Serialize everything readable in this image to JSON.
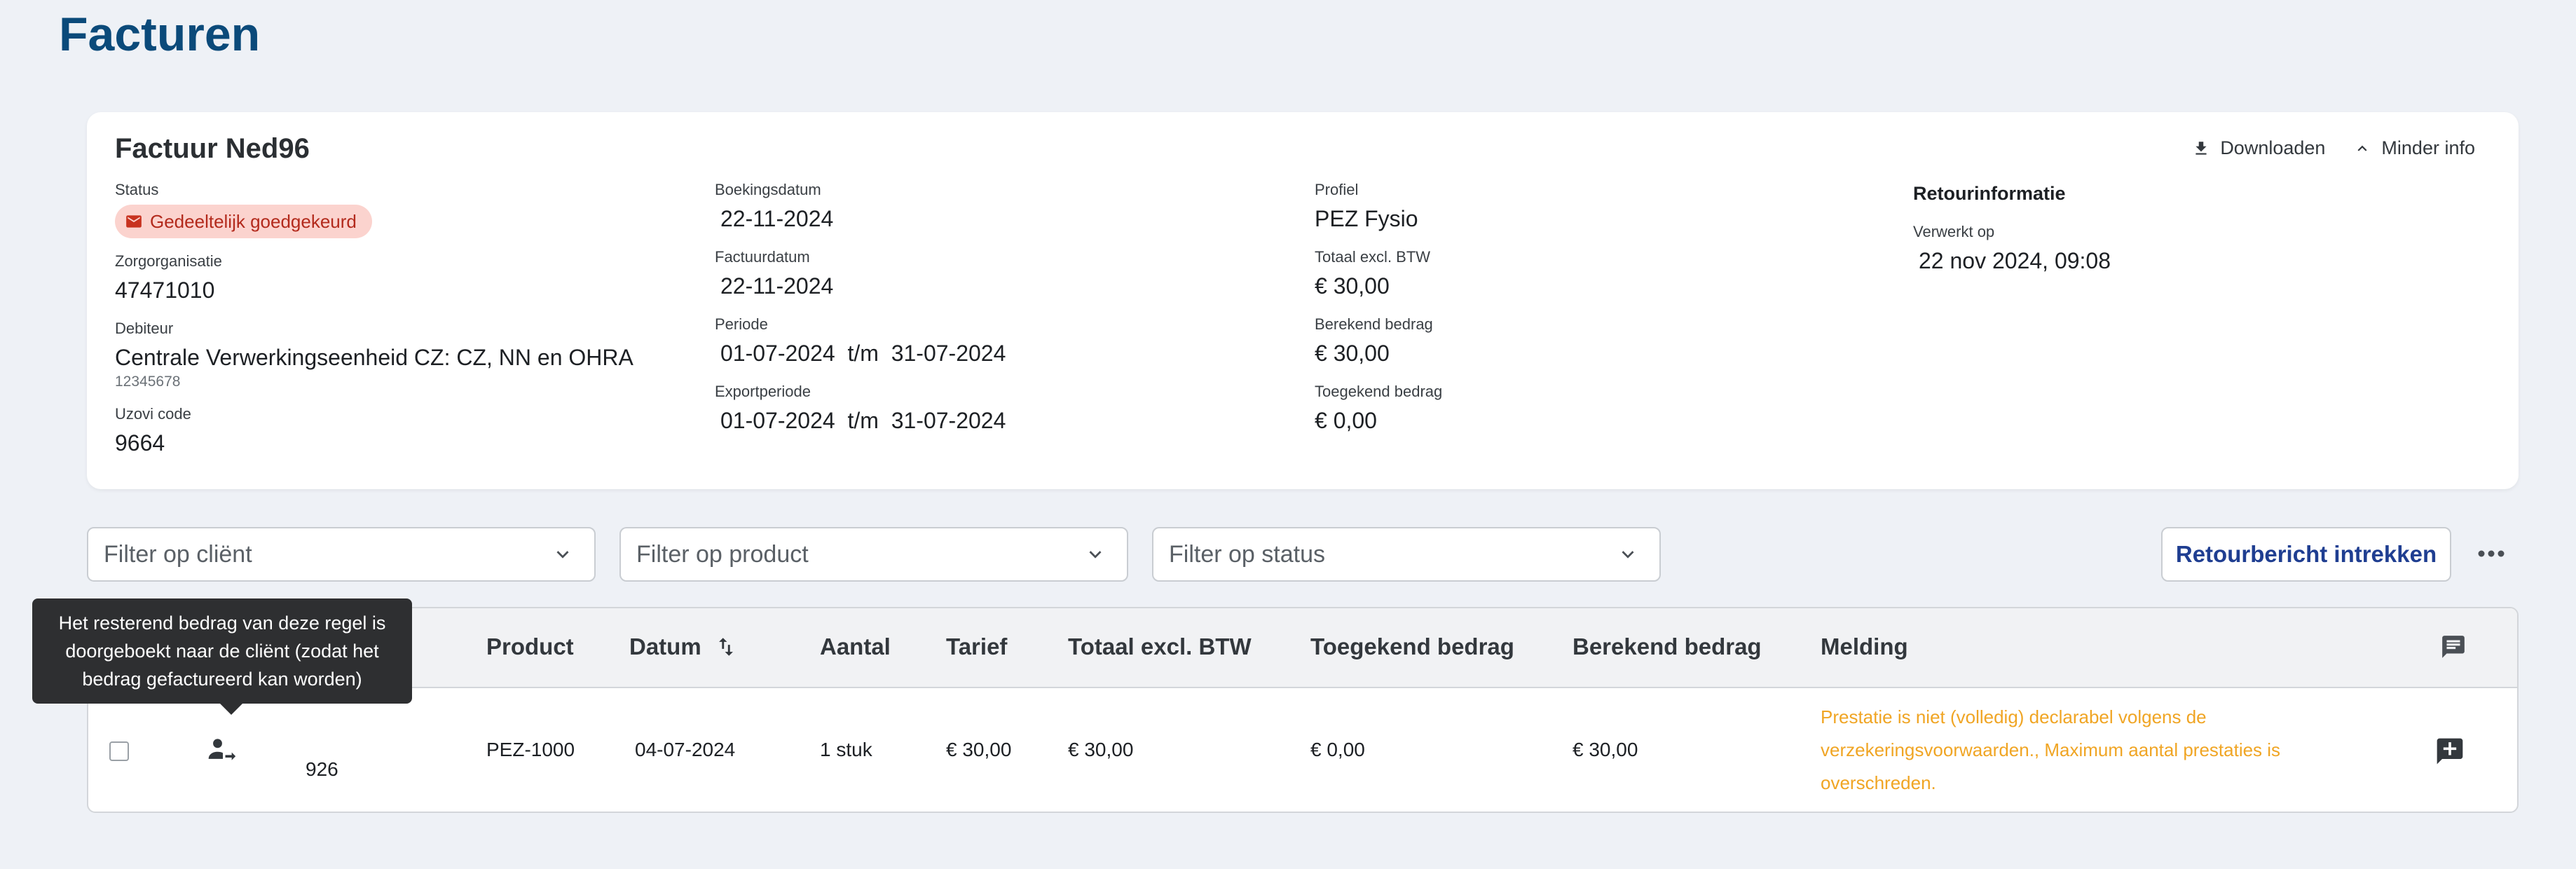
{
  "page": {
    "title": "Facturen"
  },
  "invoice": {
    "title": "Factuur Ned96",
    "actions": {
      "download": "Downloaden",
      "less_info": "Minder info"
    },
    "fields": {
      "status_label": "Status",
      "status_value": "Gedeeltelijk goedgekeurd",
      "zorgorganisatie_label": "Zorgorganisatie",
      "zorgorganisatie_value": "47471010",
      "debiteur_label": "Debiteur",
      "debiteur_value": "Centrale Verwerkingseenheid CZ: CZ, NN en OHRA",
      "debiteur_sub": "12345678",
      "uzovi_label": "Uzovi code",
      "uzovi_value": "9664",
      "boekingsdatum_label": "Boekingsdatum",
      "boekingsdatum_value": "22-11-2024",
      "factuurdatum_label": "Factuurdatum",
      "factuurdatum_value": "22-11-2024",
      "periode_label": "Periode",
      "periode_value": "01-07-2024  t/m  31-07-2024",
      "exportperiode_label": "Exportperiode",
      "exportperiode_value": "01-07-2024  t/m  31-07-2024",
      "profiel_label": "Profiel",
      "profiel_value": "PEZ Fysio",
      "totaal_label": "Totaal excl. BTW",
      "totaal_value": "€ 30,00",
      "berekend_label": "Berekend bedrag",
      "berekend_value": "€ 30,00",
      "toegekend_label": "Toegekend bedrag",
      "toegekend_value": "€ 0,00",
      "retour_heading": "Retourinformatie",
      "verwerkt_label": "Verwerkt op",
      "verwerkt_value": "22 nov 2024, 09:08"
    }
  },
  "filters": {
    "client_placeholder": "Filter op cliënt",
    "product_placeholder": "Filter op product",
    "status_placeholder": "Filter op status",
    "retour_button": "Retourbericht intrekken"
  },
  "table": {
    "headers": {
      "product": "Product",
      "datum": "Datum",
      "aantal": "Aantal",
      "tarief": "Tarief",
      "totaal": "Totaal excl. BTW",
      "toegekend": "Toegekend bedrag",
      "berekend": "Berekend bedrag",
      "melding": "Melding"
    },
    "rows": [
      {
        "id": "926",
        "product": "PEZ-1000",
        "datum": "04-07-2024",
        "aantal": "1 stuk",
        "tarief": "€ 30,00",
        "totaal": "€ 30,00",
        "toegekend": "€ 0,00",
        "berekend": "€ 30,00",
        "melding": "Prestatie is niet (volledig) declarabel volgens de verzekeringsvoorwaarden., Maximum aantal prestaties is overschreden."
      }
    ]
  },
  "tooltip": {
    "text": "Het resterend bedrag van deze regel is doorgeboekt naar de cliënt (zodat het bedrag gefactureerd kan worden)"
  },
  "colors": {
    "title": "#0b4a7a",
    "badge_bg": "#fbd3ce",
    "badge_text": "#b32a1c",
    "warning": "#f0a524",
    "primary_button": "#1f3e91"
  },
  "icons": [
    "download-icon",
    "chevron-up-icon",
    "mail-alert-icon",
    "chevron-down-icon",
    "more-horizontal-icon",
    "sort-icon",
    "comment-icon",
    "add-comment-icon",
    "person-forward-icon"
  ]
}
